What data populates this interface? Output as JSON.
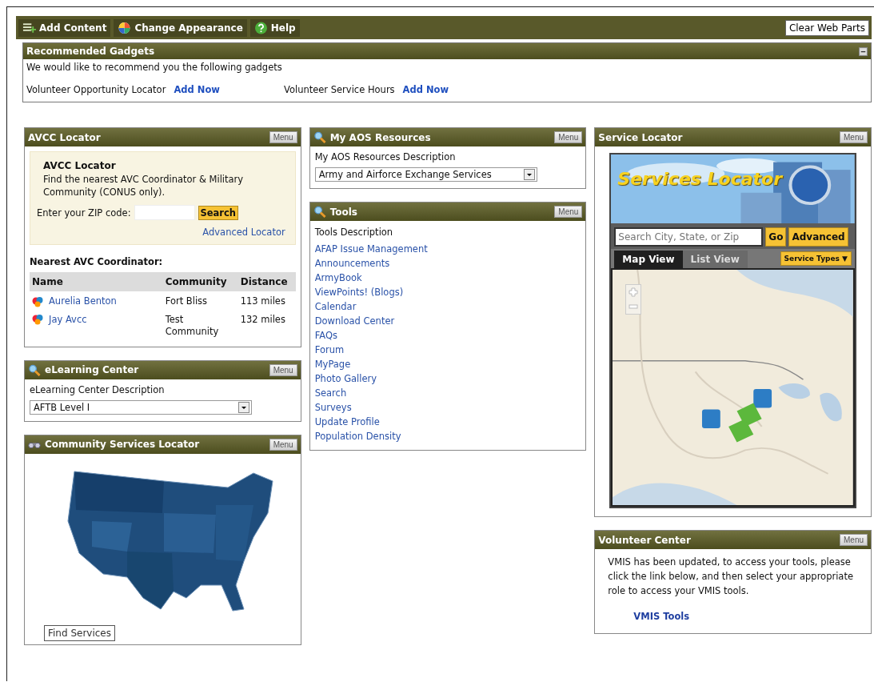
{
  "toolbar": {
    "buttons": [
      {
        "label": "Add Content",
        "kind": "add"
      },
      {
        "label": "Change Appearance",
        "kind": "appearance"
      },
      {
        "label": "Help",
        "kind": "help"
      }
    ],
    "clear_button": "Clear Web Parts"
  },
  "recommended": {
    "title": "Recommended Gadgets",
    "text": "We would like to recommend you the following gadgets",
    "gadgets": [
      {
        "name": "Volunteer Opportunity Locator",
        "action": "Add Now"
      },
      {
        "name": "Volunteer Service Hours",
        "action": "Add Now"
      }
    ]
  },
  "columns": [
    {
      "panels": [
        {
          "kind": "avcc",
          "title": "AVCC Locator",
          "menu": "Menu",
          "icon": false,
          "box_title": "AVCC Locator",
          "box_text": "Find the nearest AVC Coordinator & Military Community (CONUS only).",
          "zip_label": "Enter your ZIP code:",
          "search_button": "Search",
          "advanced_link": "Advanced Locator",
          "nearest_title": "Nearest AVC Coordinator:",
          "table": {
            "columns": [
              "Name",
              "Community",
              "Distance"
            ],
            "rows": [
              [
                "Aurelia Benton",
                "Fort Bliss",
                "113 miles"
              ],
              [
                "Jay Avcc",
                "Test Community",
                "132 miles"
              ]
            ]
          }
        },
        {
          "kind": "select",
          "title": "eLearning Center",
          "menu": "Menu",
          "icon": true,
          "description": "eLearning Center Description",
          "select_value": "AFTB Level I"
        },
        {
          "kind": "us_map",
          "title": "Community Services Locator",
          "menu": "Menu",
          "icon": true,
          "button": "Find Services"
        }
      ]
    },
    {
      "panels": [
        {
          "kind": "select",
          "title": "My AOS Resources",
          "menu": "Menu",
          "icon": true,
          "description": "My AOS Resources Description",
          "select_value": "Army and Airforce Exchange Services"
        },
        {
          "kind": "links",
          "title": "Tools",
          "menu": "Menu",
          "icon": true,
          "description": "Tools Description",
          "links": [
            "AFAP Issue Management",
            "Announcements",
            "ArmyBook",
            "ViewPoints! (Blogs)",
            "Calendar",
            "Download Center",
            "FAQs",
            "Forum",
            "MyPage",
            "Photo Gallery",
            "Search",
            "Surveys",
            "Update Profile",
            "Population Density"
          ]
        }
      ]
    },
    {
      "panels": [
        {
          "kind": "services_map",
          "title": "Service Locator",
          "menu": "Menu",
          "icon": false,
          "banner_title": "Services Locator",
          "search_placeholder": "Search City, State, or Zip",
          "go_button": "Go",
          "advanced_button": "Advanced",
          "tabs": [
            {
              "label": "Map View",
              "selected": true
            },
            {
              "label": "List View",
              "selected": false
            }
          ],
          "types_button": "Service Types ▼"
        },
        {
          "kind": "text",
          "title": "Volunteer Center",
          "menu": "Menu",
          "icon": false,
          "text": "VMIS has been updated, to access your tools, please click the link below, and then select your appropriate role to access your VMIS tools.",
          "link": "VMIS Tools"
        }
      ]
    }
  ]
}
